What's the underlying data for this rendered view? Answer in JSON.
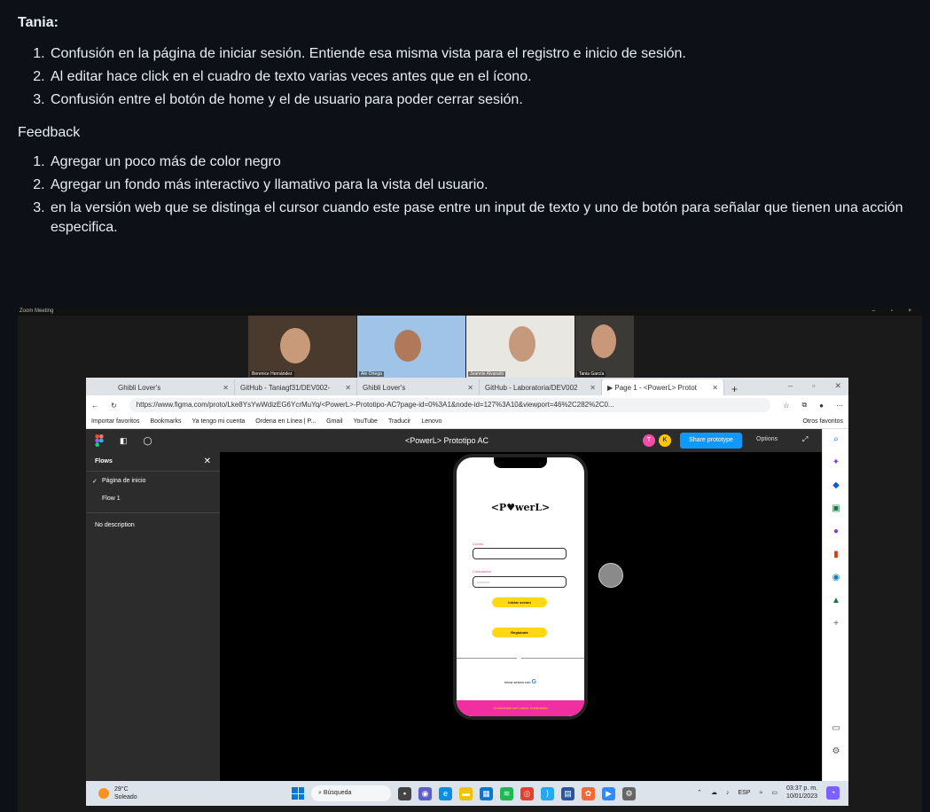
{
  "notes": {
    "title": "Tania:",
    "issues": [
      "Confusión en la página de iniciar sesión. Entiende esa misma vista para el registro e inicio de sesión.",
      "Al editar hace click en el cuadro de texto varias veces antes que en el ícono.",
      "Confusión entre el botón de home y el de usuario para poder cerrar sesión."
    ],
    "feedback_label": "Feedback",
    "feedback": [
      "Agregar un poco más de color negro",
      "Agregar un fondo más interactivo y llamativo para la vista del usuario.",
      "en la versión web que se distinga el cursor cuando este pase entre un input de texto y uno de botón para señalar que tienen una acción especifica."
    ]
  },
  "zoom": {
    "title": "Zoom Meeting",
    "controls": "– ▫ ×",
    "participants": [
      "Berenice Hernández",
      "Ale Ortega",
      "Jeannie Alvarado",
      "Tania García"
    ]
  },
  "browser": {
    "tabs": [
      "Ghibli Lover's",
      "GitHub - Taniagf31/DEV002-",
      "Ghibli Lover's",
      "GitHub - Laboratoria/DEV002",
      "▶ Page 1 - <PowerL> Protot"
    ],
    "url": "https://www.figma.com/proto/Lke8YsYwWdizEG6YcrMuYq/<PowerL>-Prototipo-AC?page-id=0%3A1&node-id=127%3A10&viewport=46%2C282%2C0...",
    "bookmarks": [
      "Importar favoritos",
      "Bookmarks",
      "Ya tengo mi cuenta",
      "Ordena en Línea | P...",
      "Gmail",
      "YouTube",
      "Traducir",
      "Lenovo"
    ],
    "other_favorites": "Otros favoritos"
  },
  "figma": {
    "file_title": "<PowerL> Prototipo AC",
    "avatars": [
      "T",
      "K"
    ],
    "share_label": "Share prototype",
    "options_label": "Options",
    "flows_header": "Flows",
    "flows": [
      "Página de inicio",
      "Flow 1"
    ],
    "no_description": "No description"
  },
  "phone": {
    "logo": "<P♥werL>",
    "email_label": "Correo",
    "password_label": "Contraseña",
    "password_value": "••••••••••",
    "login_button": "Iniciar sesion",
    "register_button": "Registrate",
    "separator": "o",
    "google_login": "Inicia sesión con",
    "footer": "Comunidad con Lasco Cubiculada"
  },
  "taskbar": {
    "temperature": "29°C",
    "condition": "Soleado",
    "search": "Búsqueda",
    "language": "ESP",
    "time": "03:37 p. m.",
    "date": "10/01/2023"
  },
  "colors": {
    "page_bg": "#0d1117",
    "share_blue": "#0d99ff",
    "button_yellow": "#ffd814",
    "accent_pink": "#f22fa0"
  }
}
